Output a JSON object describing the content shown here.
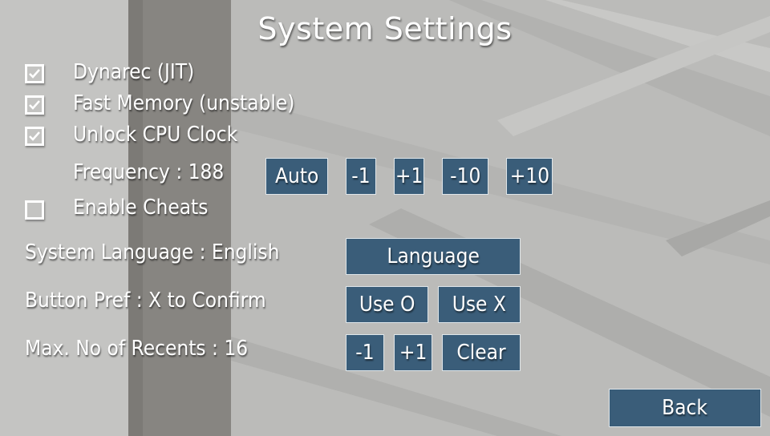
{
  "title": "System Settings",
  "colors": {
    "button_bg": "#3a5d79",
    "button_border": "#dfe6ea",
    "text": "#ffffff"
  },
  "options": {
    "dynarec": {
      "label": "Dynarec (JIT)",
      "checked": true
    },
    "fast_memory": {
      "label": "Fast Memory (unstable)",
      "checked": true
    },
    "unlock_cpu": {
      "label": "Unlock CPU Clock",
      "checked": true
    },
    "enable_cheats": {
      "label": "Enable Cheats",
      "checked": false
    }
  },
  "frequency": {
    "label": "Frequency : 188",
    "buttons": {
      "auto": "Auto",
      "minus1": "-1",
      "plus1": "+1",
      "minus10": "-10",
      "plus10": "+10"
    }
  },
  "language": {
    "label": "System Language : English",
    "button": "Language"
  },
  "button_pref": {
    "label": "Button Pref : X to Confirm",
    "use_o": "Use O",
    "use_x": "Use X"
  },
  "recents": {
    "label": "Max. No of Recents : 16",
    "minus1": "-1",
    "plus1": "+1",
    "clear": "Clear"
  },
  "back": "Back",
  "icons": {
    "checkbox_checked": "checkmark-icon"
  }
}
